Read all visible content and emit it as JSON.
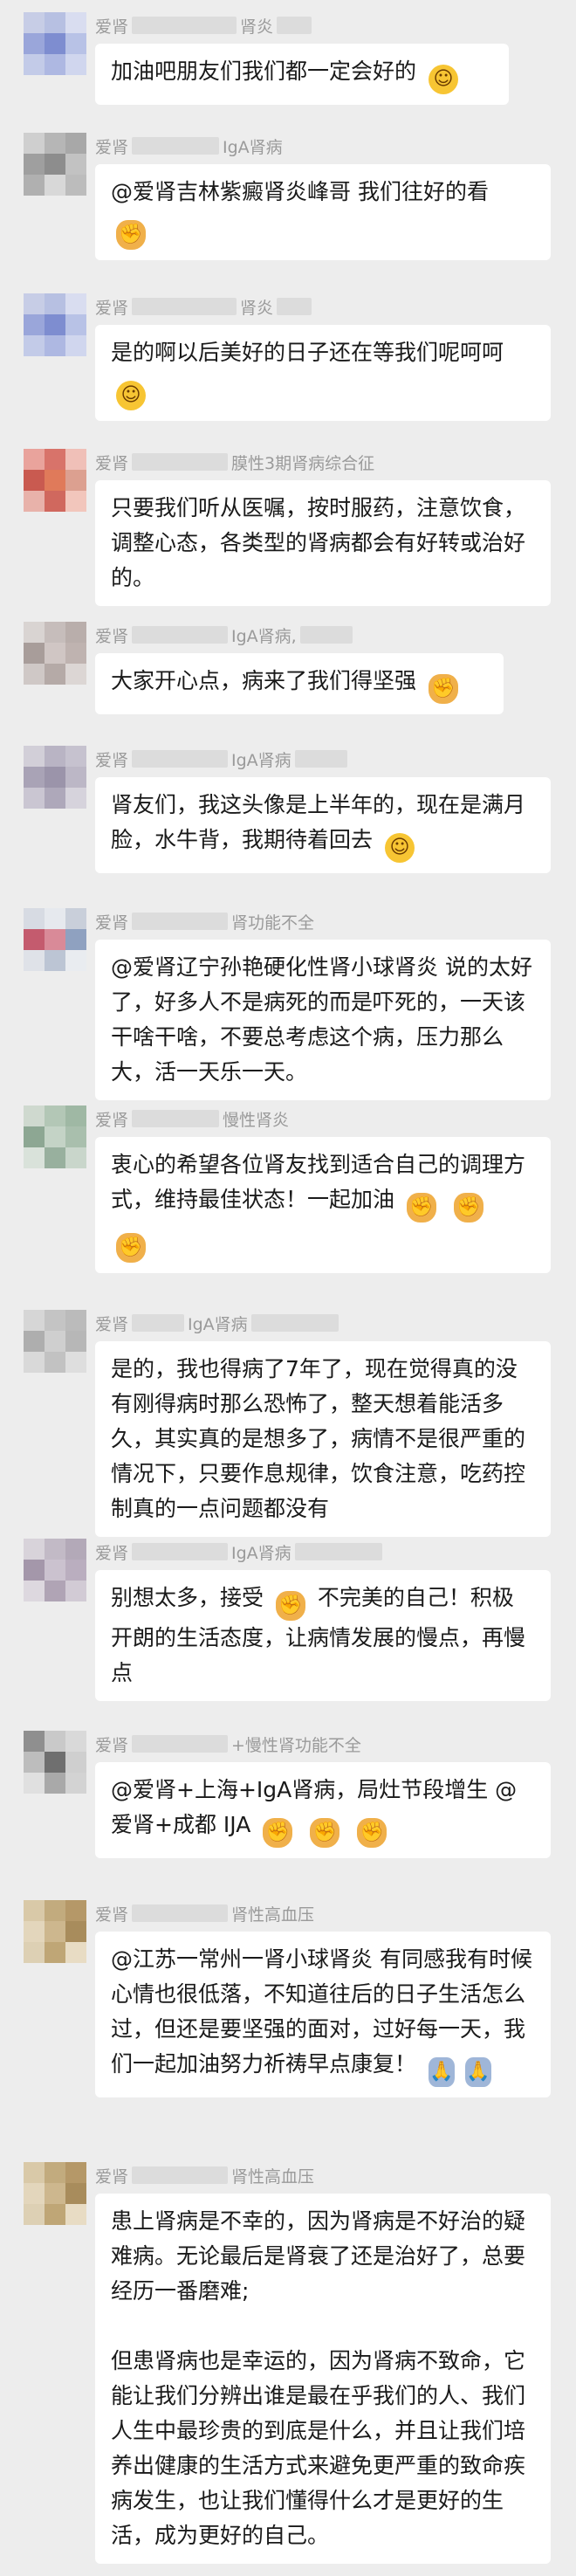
{
  "messages": [
    {
      "id": "m1",
      "name_left": "爱肾",
      "name_right": "肾炎",
      "avatar_colors": [
        "#c7cde6",
        "#b7c0e2",
        "#d9ddf0",
        "#9aa6da",
        "#7e8dd0",
        "#b8c2e6",
        "#c3cbe8",
        "#aeb8e2",
        "#d0d6ee"
      ],
      "paragraphs": [
        "加油吧朋友们我们都一定会好的 [smile]"
      ]
    },
    {
      "id": "m2",
      "name_left": "爱肾",
      "name_right": "IgA肾病",
      "avatar_colors": [
        "#cfcfcf",
        "#b6b6b6",
        "#a8a8a8",
        "#9f9f9f",
        "#8d8d8d",
        "#c2c2c2",
        "#b0b0b0",
        "#d8d8d8",
        "#bcbcbc"
      ],
      "paragraphs": [
        "@爱肾吉林紫癜肾炎峰哥 我们往好的看 [fist]"
      ]
    },
    {
      "id": "m3",
      "name_left": "爱肾",
      "name_right": "肾炎",
      "avatar_colors": [
        "#c7cde6",
        "#b7c0e2",
        "#d9ddf0",
        "#9aa6da",
        "#7e8dd0",
        "#b8c2e6",
        "#c3cbe8",
        "#aeb8e2",
        "#d0d6ee"
      ],
      "paragraphs": [
        "是的啊以后美好的日子还在等我们呢呵呵 [smile]"
      ]
    },
    {
      "id": "m4",
      "name_left": "爱肾",
      "name_right": "膜性3期肾病综合征",
      "avatar_colors": [
        "#e9a39c",
        "#d8736a",
        "#f0c0b8",
        "#c95a50",
        "#e07a5a",
        "#dca090",
        "#e8b2aa",
        "#d0685e",
        "#f2c6bc"
      ],
      "paragraphs": [
        "只要我们听从医嘱，按时服药，注意饮食，调整心态，各类型的肾病都会有好转或治好的。"
      ]
    },
    {
      "id": "m5",
      "name_left": "爱肾",
      "name_right": "IgA肾病,",
      "avatar_colors": [
        "#d9d4d2",
        "#c6bdbb",
        "#b9aeab",
        "#a89d9a",
        "#d0c6c4",
        "#bfb3b0",
        "#cfc8c6",
        "#b5aaa7",
        "#dcd6d4"
      ],
      "paragraphs": [
        "大家开心点，病来了我们得坚强 [fist]"
      ]
    },
    {
      "id": "m6",
      "name_left": "爱肾",
      "name_right": "IgA肾病",
      "avatar_colors": [
        "#d2cfd8",
        "#b9b4c4",
        "#c6c2cf",
        "#a9a3b6",
        "#9b94aa",
        "#bcb7c6",
        "#cac6d2",
        "#aea8ba",
        "#d6d3dc"
      ],
      "paragraphs": [
        "肾友们，我这头像是上半年的，现在是满月脸，水牛背，我期待着回去 [smile]"
      ]
    },
    {
      "id": "m7",
      "name_left": "爱肾",
      "name_right": "肾功能不全",
      "avatar_colors": [
        "#d7dbe3",
        "#e6e9ee",
        "#c9cfda",
        "#c45b6e",
        "#d98a98",
        "#8fa1c0",
        "#dfe2e8",
        "#bcc5d4",
        "#e9ecf0"
      ],
      "paragraphs": [
        "@爱肾辽宁孙艳硬化性肾小球肾炎 说的太好了，好多人不是病死的而是吓死的，一天该干啥干啥，不要总考虑这个病，压力那么大，活一天乐一天。"
      ]
    },
    {
      "id": "m8",
      "name_left": "爱肾",
      "name_right": "慢性肾炎",
      "avatar_colors": [
        "#cfd9cf",
        "#b3c7b6",
        "#9fb8a4",
        "#8da793",
        "#c4d3c6",
        "#a9bfad",
        "#d9e2da",
        "#98b09e",
        "#c9d6cb"
      ],
      "paragraphs": [
        "衷心的希望各位肾友找到适合自己的调理方式，维持最佳状态！一起加油 [fist] [fist] [fist]"
      ]
    },
    {
      "id": "m9",
      "name_left": "爱肾",
      "name_right": "IgA肾病",
      "avatar_colors": [
        "#d6d6d6",
        "#c4c4c4",
        "#bbbbbb",
        "#aeaeae",
        "#cfcfcf",
        "#b7b7b7",
        "#d9d9d9",
        "#c2c2c2",
        "#dedede"
      ],
      "paragraphs": [
        "是的，我也得病了7年了，现在觉得真的没有刚得病时那么恐怖了，整天想着能活多久，其实真的是想多了，病情不是很严重的情况下，只要作息规律，饮食注意，吃药控制真的一点问题都没有"
      ]
    },
    {
      "id": "m10",
      "name_left": "爱肾",
      "name_right": "IgA肾病",
      "avatar_colors": [
        "#d8d3da",
        "#c2bac6",
        "#b3a9b8",
        "#a497aa",
        "#cbc2cf",
        "#baaebf",
        "#ddd8df",
        "#b0a4b5",
        "#d2cbd5"
      ],
      "paragraphs": [
        "别想太多，接受 [fist] 不完美的自己！积极开朗的生活态度，让病情发展的慢点，再慢点"
      ]
    },
    {
      "id": "m11",
      "name_left": "爱肾",
      "name_right": "+慢性肾功能不全",
      "avatar_colors": [
        "#8f8f8f",
        "#c9c9c9",
        "#d9d9d9",
        "#bdbdbd",
        "#6f6f6f",
        "#cfcfcf",
        "#e0e0e0",
        "#a9a9a9",
        "#d3d3d3"
      ],
      "paragraphs": [
        "@爱肾+上海+IgA肾病，局灶节段增生 @爱肾+成都 IJA [fist] [fist] [fist]"
      ]
    },
    {
      "id": "m12",
      "name_left": "爱肾",
      "name_right": "肾性高血压",
      "avatar_colors": [
        "#d9c9a8",
        "#c2ab7e",
        "#b59868",
        "#e3d6bc",
        "#cdb78e",
        "#a88c5c",
        "#ddd0b4",
        "#bfa676",
        "#e8dcc4"
      ],
      "paragraphs": [
        "@江苏一常州一肾小球肾炎 有同感我有时候心情也很低落，不知道往后的日子生活怎么过，但还是要坚强的面对，过好每一天，我们一起加油努力祈祷早点康复！ [pray][pray]"
      ]
    },
    {
      "id": "m13",
      "name_left": "爱肾",
      "name_right": "肾性高血压",
      "avatar_colors": [
        "#d9c9a8",
        "#c2ab7e",
        "#b59868",
        "#e3d6bc",
        "#cdb78e",
        "#a88c5c",
        "#ddd0b4",
        "#bfa676",
        "#e8dcc4"
      ],
      "paragraphs": [
        "患上肾病是不幸的，因为肾病是不好治的疑难病。无论最后是肾衰了还是治好了，总要经历一番磨难;",
        "",
        "但患肾病也是幸运的，因为肾病不致命，它能让我们分辨出谁是最在乎我们的人、我们人生中最珍贵的到底是什么，并且让我们培养出健康的生活方式来避免更严重的致命疾病发生，也让我们懂得什么才是更好的生活，成为更好的自己。"
      ]
    }
  ]
}
